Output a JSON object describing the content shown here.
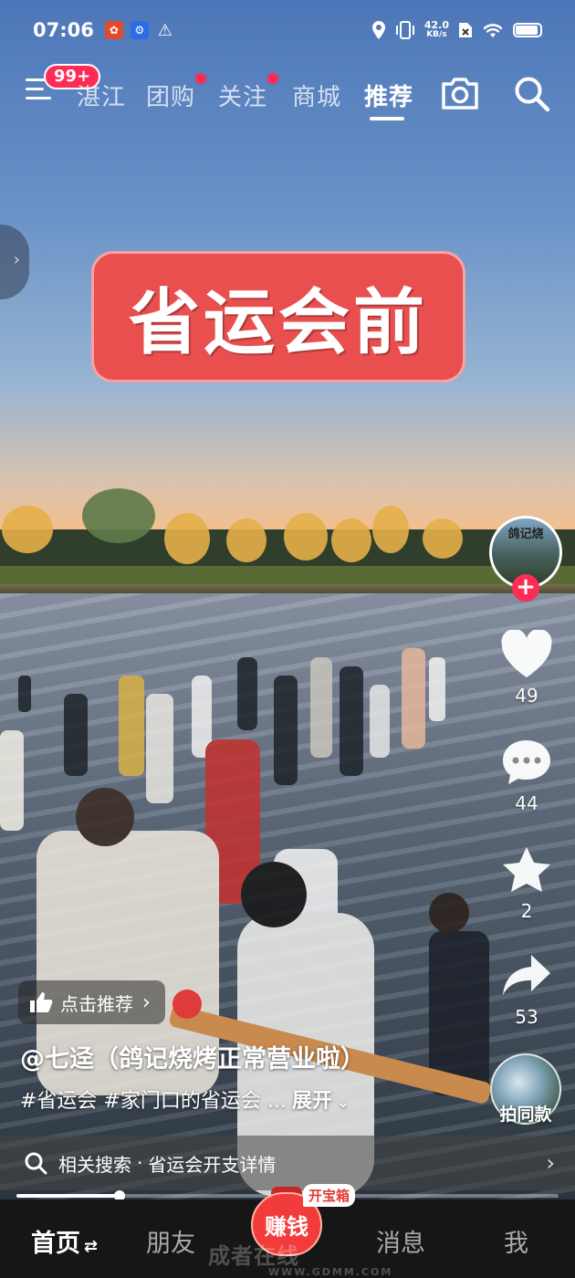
{
  "status_bar": {
    "time": "07:06",
    "net_speed_value": "42.0",
    "net_speed_unit": "KB/s",
    "battery_level": 0.85,
    "icons": [
      "app-notification-icon",
      "app-notification-icon-2",
      "warning-icon",
      "location-icon",
      "vibrate-icon",
      "sim-off-icon",
      "wifi-icon",
      "battery-icon"
    ]
  },
  "top_nav": {
    "badge": "99+",
    "tabs": [
      {
        "label": "湛江",
        "active": false,
        "dot": false
      },
      {
        "label": "团购",
        "active": false,
        "dot": true
      },
      {
        "label": "关注",
        "active": false,
        "dot": true
      },
      {
        "label": "商城",
        "active": false,
        "dot": false
      },
      {
        "label": "推荐",
        "active": true,
        "dot": false
      }
    ],
    "accent": "#fe2c55"
  },
  "video": {
    "overlay_caption": "省运会前",
    "caption_color": "#e94f4f"
  },
  "right_rail": {
    "avatar_text": "鸽记烧",
    "likes": "49",
    "comments": "44",
    "favorites": "2",
    "shares": "53",
    "same_style_label": "拍同款"
  },
  "info": {
    "recommend_label": "点击推荐",
    "author": "@七迳（鸽记烧烤正常营业啦）",
    "description": "#省运会 #家门口的省运会 ...",
    "expand_label": "展开"
  },
  "related_search": {
    "prefix": "相关搜索",
    "separator": "·",
    "query": "省运会开支详情"
  },
  "progress": {
    "fraction": 0.19
  },
  "tab_bar": {
    "home": "首页",
    "friends": "朋友",
    "earn": "赚钱",
    "treasure_tag": "开宝箱",
    "messages": "消息",
    "me": "我"
  },
  "watermark": {
    "text": "成者在线",
    "url": "WWW.GDMM.COM"
  }
}
